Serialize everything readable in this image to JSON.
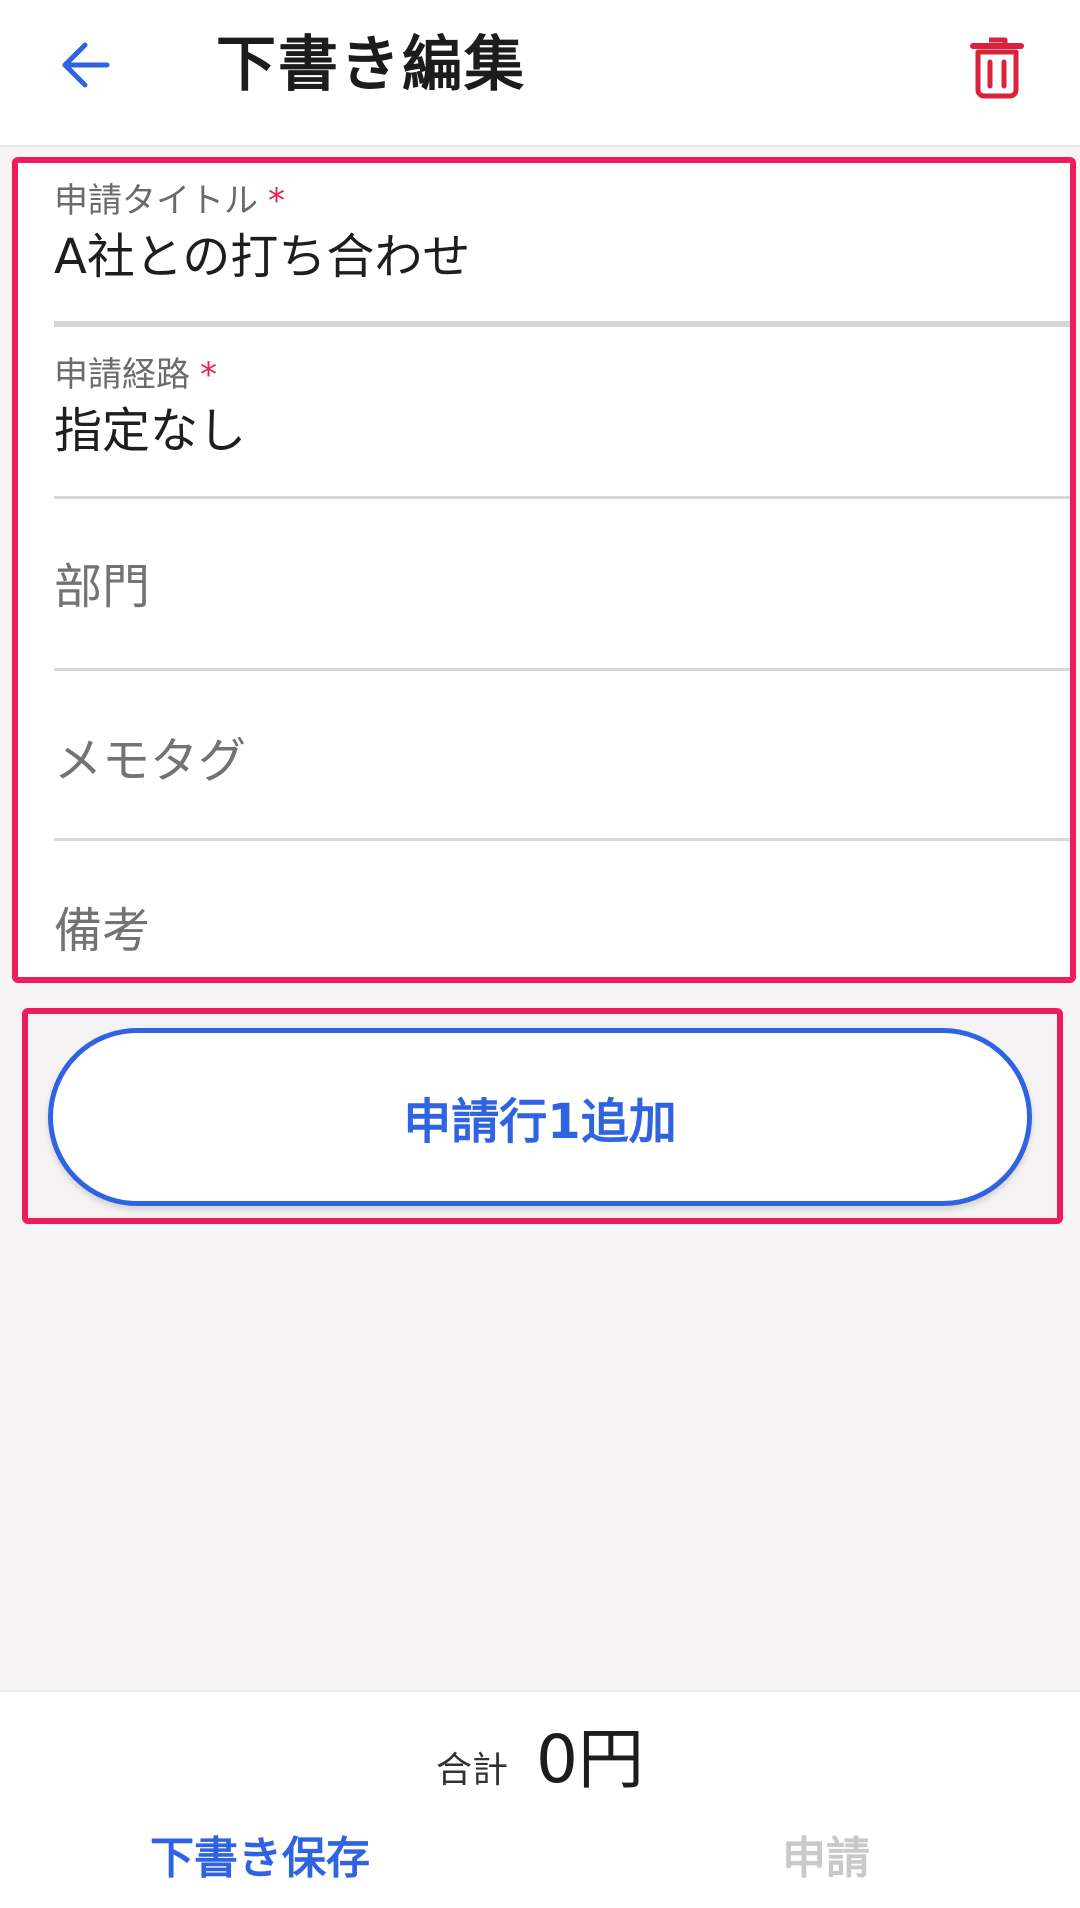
{
  "header": {
    "title": "下書き編集",
    "back_icon": "arrow-left-icon",
    "trash_icon": "trash-icon"
  },
  "form": {
    "title_field": {
      "label": "申請タイトル",
      "required_mark": "*",
      "value": "A社との打ち合わせ"
    },
    "route_field": {
      "label": "申請経路",
      "required_mark": "*",
      "value": "指定なし"
    },
    "department_field": {
      "placeholder": "部門"
    },
    "memo_tag_field": {
      "placeholder": "メモタグ"
    },
    "remarks_field": {
      "placeholder": "備考"
    }
  },
  "add_row_button": {
    "label": "申請行1追加"
  },
  "footer": {
    "total_label": "合計",
    "total_amount": "0円",
    "save_draft_label": "下書き保存",
    "submit_label": "申請"
  },
  "colors": {
    "accent_blue": "#2f63e2",
    "highlight_pink": "#ef1c5c",
    "trash_red": "#d9223c",
    "required_red": "#e8204f",
    "disabled_gray": "#c9c9c9"
  }
}
